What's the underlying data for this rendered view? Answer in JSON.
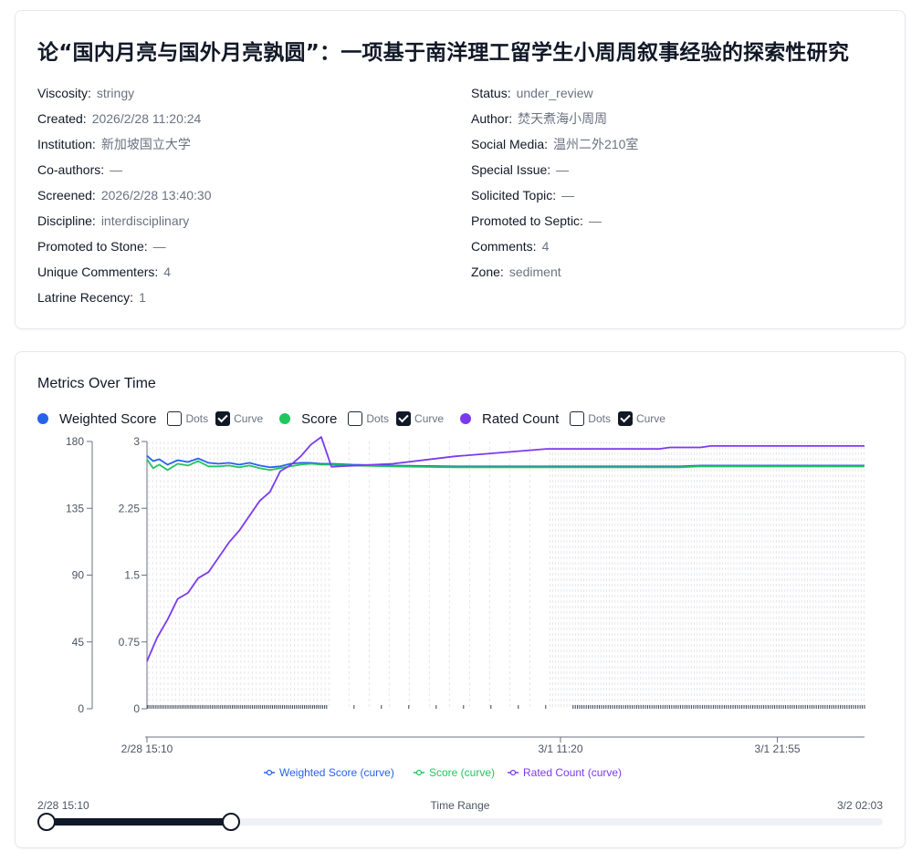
{
  "paper": {
    "title": "论“国内月亮与国外月亮孰圆”：一项基于南洋理工留学生小周周叙事经验的探索性研究",
    "left_fields": [
      {
        "key": "Viscosity:",
        "value": "stringy"
      },
      {
        "key": "Created:",
        "value": "2026/2/28 11:20:24"
      },
      {
        "key": "Institution:",
        "value": "新加坡国立大学"
      },
      {
        "key": "Co-authors:",
        "value": "—"
      },
      {
        "key": "Screened:",
        "value": "2026/2/28 13:40:30"
      },
      {
        "key": "Discipline:",
        "value": "interdisciplinary"
      },
      {
        "key": "Promoted to Stone:",
        "value": "—"
      },
      {
        "key": "Unique Commenters:",
        "value": "4"
      },
      {
        "key": "Latrine Recency:",
        "value": "1"
      }
    ],
    "right_fields": [
      {
        "key": "Status:",
        "value": "under_review"
      },
      {
        "key": "Author:",
        "value": "焚天煮海小周周"
      },
      {
        "key": "Social Media:",
        "value": "温州二外210室"
      },
      {
        "key": "Special Issue:",
        "value": "—"
      },
      {
        "key": "Solicited Topic:",
        "value": "—"
      },
      {
        "key": "Promoted to Septic:",
        "value": "—"
      },
      {
        "key": "Comments:",
        "value": "4"
      },
      {
        "key": "Zone:",
        "value": "sediment"
      }
    ]
  },
  "chart_card": {
    "title": "Metrics Over Time",
    "dots_label": "Dots",
    "curve_label": "Curve",
    "series_controls": [
      {
        "name": "Weighted Score",
        "color": "#2563eb",
        "dots": false,
        "curve": true
      },
      {
        "name": "Score",
        "color": "#22c55e",
        "dots": false,
        "curve": true
      },
      {
        "name": "Rated Count",
        "color": "#7c3aed",
        "dots": false,
        "curve": true
      }
    ],
    "range": {
      "label": "Time Range",
      "start": "2/28 15:10",
      "end": "3/2 02:03",
      "low_fraction": 0.0,
      "high_fraction": 0.22
    }
  },
  "chart_data": {
    "type": "line",
    "x_ticks": [
      "2/28 15:10",
      "3/1 11:20",
      "3/1 21:55"
    ],
    "left_axis": {
      "ticks": [
        "0",
        "45",
        "90",
        "135",
        "180"
      ],
      "ylim": [
        0,
        180
      ]
    },
    "right_axis": {
      "ticks": [
        "0",
        "0.75",
        "1.5",
        "2.25",
        "3"
      ],
      "ylim": [
        0,
        3
      ]
    },
    "x_range_hours": [
      0,
      35
    ],
    "x_tick_hours": [
      0,
      20.17,
      30.75
    ],
    "legend": [
      "Weighted Score (curve)",
      "Score (curve)",
      "Rated Count (curve)"
    ],
    "series": [
      {
        "name": "Weighted Score",
        "axis": "right",
        "color": "#2563eb",
        "x": [
          0,
          0.3,
          0.6,
          1.0,
          1.5,
          2.0,
          2.5,
          3.0,
          3.5,
          4.0,
          4.5,
          5.0,
          5.5,
          6.0,
          6.5,
          7.0,
          7.5,
          8.0,
          8.5,
          9.0,
          10.0,
          12.0,
          15.0,
          20.0,
          26.0,
          27.0,
          30.0,
          35.0
        ],
        "y": [
          2.84,
          2.78,
          2.8,
          2.74,
          2.79,
          2.77,
          2.81,
          2.76,
          2.75,
          2.76,
          2.74,
          2.76,
          2.73,
          2.71,
          2.72,
          2.75,
          2.76,
          2.76,
          2.75,
          2.75,
          2.74,
          2.73,
          2.72,
          2.72,
          2.72,
          2.73,
          2.73,
          2.73
        ]
      },
      {
        "name": "Score",
        "axis": "right",
        "color": "#22c55e",
        "x": [
          0,
          0.3,
          0.6,
          1.0,
          1.5,
          2.0,
          2.5,
          3.0,
          3.5,
          4.0,
          4.5,
          5.0,
          5.5,
          6.0,
          6.5,
          7.0,
          7.5,
          8.0,
          8.5,
          9.0,
          10.0,
          12.0,
          15.0,
          20.0,
          26.0,
          27.0,
          30.0,
          35.0
        ],
        "y": [
          2.8,
          2.7,
          2.74,
          2.68,
          2.75,
          2.73,
          2.78,
          2.72,
          2.72,
          2.73,
          2.71,
          2.73,
          2.7,
          2.68,
          2.7,
          2.72,
          2.74,
          2.75,
          2.74,
          2.74,
          2.73,
          2.72,
          2.71,
          2.71,
          2.71,
          2.72,
          2.72,
          2.72
        ]
      },
      {
        "name": "Rated Count",
        "axis": "left",
        "color": "#7c3aed",
        "x": [
          0,
          0.5,
          1.0,
          1.5,
          2.0,
          2.5,
          3.0,
          3.5,
          4.0,
          4.5,
          5.0,
          5.5,
          6.0,
          6.5,
          7.0,
          7.5,
          8.0,
          8.5,
          9.0,
          12.0,
          15.0,
          19.5,
          25.0,
          25.5,
          27.0,
          27.5,
          35.0
        ],
        "y": [
          32,
          48,
          60,
          74,
          78,
          88,
          92,
          102,
          112,
          120,
          130,
          140,
          146,
          160,
          164,
          170,
          178,
          183,
          163,
          165,
          170,
          175,
          175,
          176,
          176,
          177,
          177
        ]
      }
    ]
  }
}
